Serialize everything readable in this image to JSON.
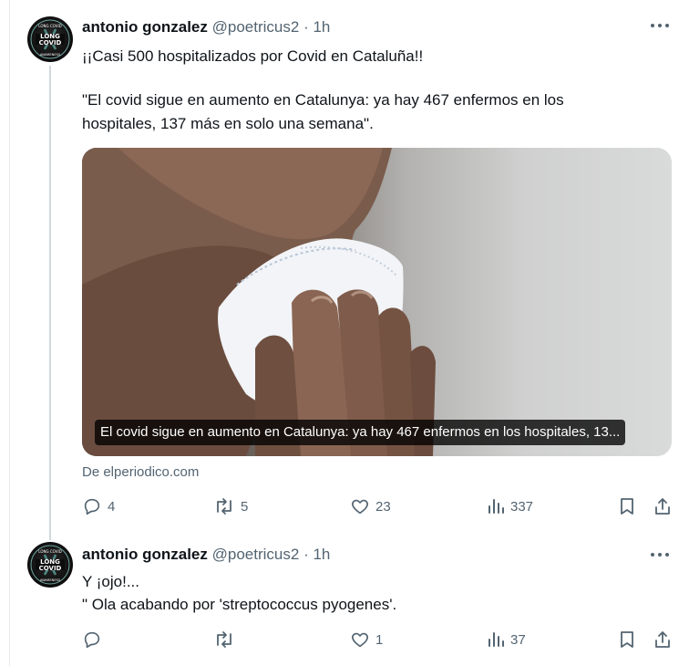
{
  "tweets": [
    {
      "author": {
        "name": "antonio gonzalez",
        "handle": "@poetricus2",
        "avatar_badge": {
          "top": "LONG COVID",
          "line1": "LONG",
          "line2": "COVID",
          "bottom": "AWARENESS"
        }
      },
      "separator": "·",
      "time": "1h",
      "text_lines": [
        "¡¡Casi 500 hospitalizados por Covid en Cataluña!!",
        "\"El covid sigue en aumento en Catalunya: ya hay 467 enfermos en los",
        "hospitales, 137 más en solo una semana\"."
      ],
      "link_card": {
        "caption": "El covid sigue en aumento en Catalunya: ya hay 467 enfermos en los hospitales, 13...",
        "source": "De elperiodico.com"
      },
      "actions": {
        "replies": "4",
        "reposts": "5",
        "likes": "23",
        "views": "337"
      }
    },
    {
      "author": {
        "name": "antonio gonzalez",
        "handle": "@poetricus2",
        "avatar_badge": {
          "top": "LONG COVID",
          "line1": "LONG",
          "line2": "COVID",
          "bottom": "AWARENESS"
        }
      },
      "separator": "·",
      "time": "1h",
      "text_lines": [
        "Y ¡ojo!...",
        "\" Ola acabando por 'streptococcus pyogenes'."
      ],
      "actions": {
        "replies": "",
        "reposts": "",
        "likes": "1",
        "views": "37"
      }
    }
  ],
  "icons": {
    "more": "more-horizontal-icon",
    "reply": "reply-icon",
    "repost": "repost-icon",
    "like": "heart-icon",
    "views": "views-chart-icon",
    "bookmark": "bookmark-icon",
    "share": "share-icon"
  },
  "colors": {
    "text": "#0f1419",
    "muted": "#536471",
    "border": "#e7e9ea",
    "thread": "#cfd9de"
  }
}
